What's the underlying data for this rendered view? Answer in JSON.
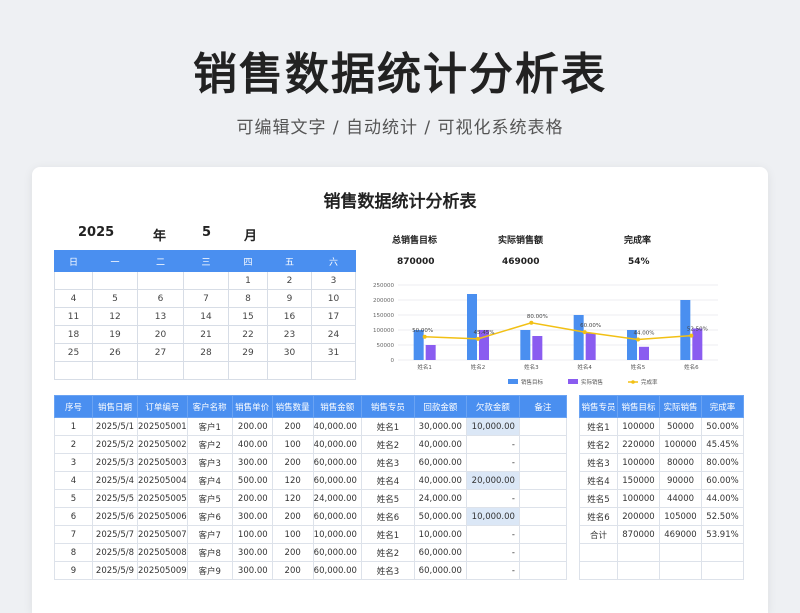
{
  "hero": {
    "title": "销售数据统计分析表",
    "subtitle": "可编辑文字 / 自动统计 / 可视化系统表格"
  },
  "card": {
    "title": "销售数据统计分析表",
    "year": "2025",
    "year_label": "年",
    "month": "5",
    "month_label": "月"
  },
  "calendar": {
    "headers": [
      "日",
      "一",
      "二",
      "三",
      "四",
      "五",
      "六"
    ],
    "rows": [
      [
        "",
        "",
        "",
        "",
        "1",
        "2",
        "3"
      ],
      [
        "4",
        "5",
        "6",
        "7",
        "8",
        "9",
        "10"
      ],
      [
        "11",
        "12",
        "13",
        "14",
        "15",
        "16",
        "17"
      ],
      [
        "18",
        "19",
        "20",
        "21",
        "22",
        "23",
        "24"
      ],
      [
        "25",
        "26",
        "27",
        "28",
        "29",
        "30",
        "31"
      ],
      [
        "",
        "",
        "",
        "",
        "",
        "",
        ""
      ]
    ]
  },
  "kpi": {
    "target_label": "总销售目标",
    "target_value": "870000",
    "actual_label": "实际销售额",
    "actual_value": "469000",
    "rate_label": "完成率",
    "rate_value": "54%"
  },
  "chart_data": {
    "type": "bar",
    "categories": [
      "姓名1",
      "姓名2",
      "姓名3",
      "姓名4",
      "姓名5",
      "姓名6"
    ],
    "series": [
      {
        "name": "销售目标",
        "type": "bar",
        "color": "#4a8ff0",
        "values": [
          100000,
          220000,
          100000,
          150000,
          100000,
          200000
        ]
      },
      {
        "name": "实际销售",
        "type": "bar",
        "color": "#8a5cf0",
        "values": [
          50000,
          100000,
          80000,
          90000,
          44000,
          105000
        ]
      },
      {
        "name": "完成率",
        "type": "line",
        "color": "#f2c014",
        "values": [
          0.5,
          0.4545,
          0.8,
          0.6,
          0.44,
          0.525
        ],
        "labels": [
          "50.00%",
          "45.45%",
          "80.00%",
          "60.00%",
          "44.00%",
          "52.50%"
        ]
      }
    ],
    "y_ticks": [
      "0",
      "50000",
      "100000",
      "150000",
      "200000",
      "250000"
    ],
    "ylim": [
      0,
      250000
    ],
    "legend_position": "bottom"
  },
  "orders": {
    "headers": [
      "序号",
      "销售日期",
      "订单编号",
      "客户名称",
      "销售单价",
      "销售数量",
      "销售金额",
      "销售专员",
      "回款金额",
      "欠款金额",
      "备注"
    ],
    "rows": [
      [
        "1",
        "2025/5/1",
        "202505001",
        "客户1",
        "200.00",
        "200",
        "40,000.00",
        "姓名1",
        "30,000.00",
        "10,000.00",
        ""
      ],
      [
        "2",
        "2025/5/2",
        "202505002",
        "客户2",
        "400.00",
        "100",
        "40,000.00",
        "姓名2",
        "40,000.00",
        "-",
        ""
      ],
      [
        "3",
        "2025/5/3",
        "202505003",
        "客户3",
        "300.00",
        "200",
        "60,000.00",
        "姓名3",
        "60,000.00",
        "-",
        ""
      ],
      [
        "4",
        "2025/5/4",
        "202505004",
        "客户4",
        "500.00",
        "120",
        "60,000.00",
        "姓名4",
        "40,000.00",
        "20,000.00",
        ""
      ],
      [
        "5",
        "2025/5/5",
        "202505005",
        "客户5",
        "200.00",
        "120",
        "24,000.00",
        "姓名5",
        "24,000.00",
        "-",
        ""
      ],
      [
        "6",
        "2025/5/6",
        "202505006",
        "客户6",
        "300.00",
        "200",
        "60,000.00",
        "姓名6",
        "50,000.00",
        "10,000.00",
        ""
      ],
      [
        "7",
        "2025/5/7",
        "202505007",
        "客户7",
        "100.00",
        "100",
        "10,000.00",
        "姓名1",
        "10,000.00",
        "-",
        ""
      ],
      [
        "8",
        "2025/5/8",
        "202505008",
        "客户8",
        "300.00",
        "200",
        "60,000.00",
        "姓名2",
        "60,000.00",
        "-",
        ""
      ],
      [
        "9",
        "2025/5/9",
        "202505009",
        "客户9",
        "300.00",
        "200",
        "60,000.00",
        "姓名3",
        "60,000.00",
        "-",
        ""
      ]
    ]
  },
  "summary": {
    "headers": [
      "销售专员",
      "销售目标",
      "实际销售",
      "完成率"
    ],
    "rows": [
      [
        "姓名1",
        "100000",
        "50000",
        "50.00%"
      ],
      [
        "姓名2",
        "220000",
        "100000",
        "45.45%"
      ],
      [
        "姓名3",
        "100000",
        "80000",
        "80.00%"
      ],
      [
        "姓名4",
        "150000",
        "90000",
        "60.00%"
      ],
      [
        "姓名5",
        "100000",
        "44000",
        "44.00%"
      ],
      [
        "姓名6",
        "200000",
        "105000",
        "52.50%"
      ],
      [
        "合计",
        "870000",
        "469000",
        "53.91%"
      ],
      [
        "",
        "",
        "",
        ""
      ],
      [
        "",
        "",
        "",
        ""
      ]
    ]
  }
}
